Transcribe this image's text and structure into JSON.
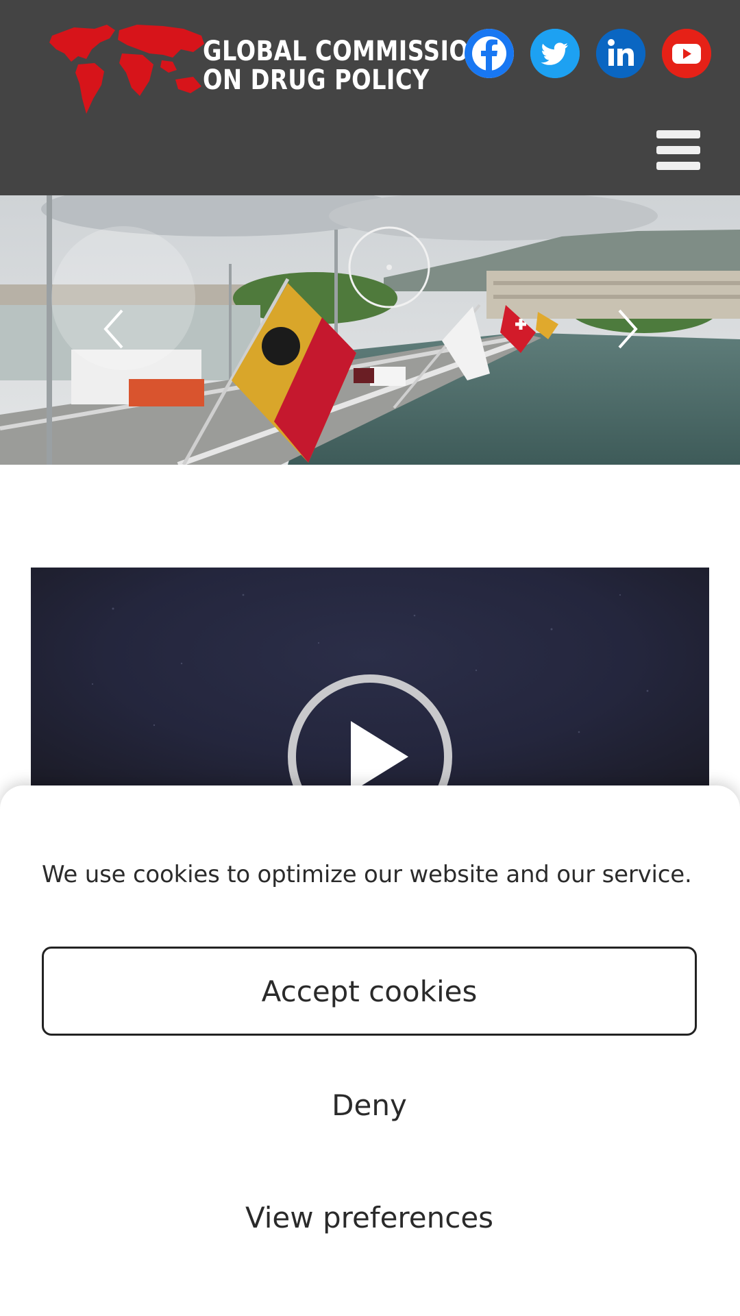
{
  "header": {
    "logo": {
      "line1": "GLOBAL COMMISSION",
      "line2": "ON DRUG POLICY",
      "icon": "world-map-logo"
    },
    "social": [
      {
        "name": "facebook-icon",
        "color": "#1877F2"
      },
      {
        "name": "twitter-icon",
        "color": "#1DA1F2"
      },
      {
        "name": "linkedin-icon",
        "color": "#0A66C2"
      },
      {
        "name": "youtube-icon",
        "color": "#E62117"
      }
    ],
    "menu_icon": "hamburger-menu-icon",
    "background": "#444444"
  },
  "hero": {
    "image": "geneva-bridge-flags-photo",
    "prev_icon": "chevron-left-icon",
    "next_icon": "chevron-right-icon"
  },
  "video": {
    "play_icon": "play-icon"
  },
  "cookie_banner": {
    "message": "We use cookies to optimize our website and our service.",
    "accept_label": "Accept cookies",
    "deny_label": "Deny",
    "preferences_label": "View preferences"
  }
}
